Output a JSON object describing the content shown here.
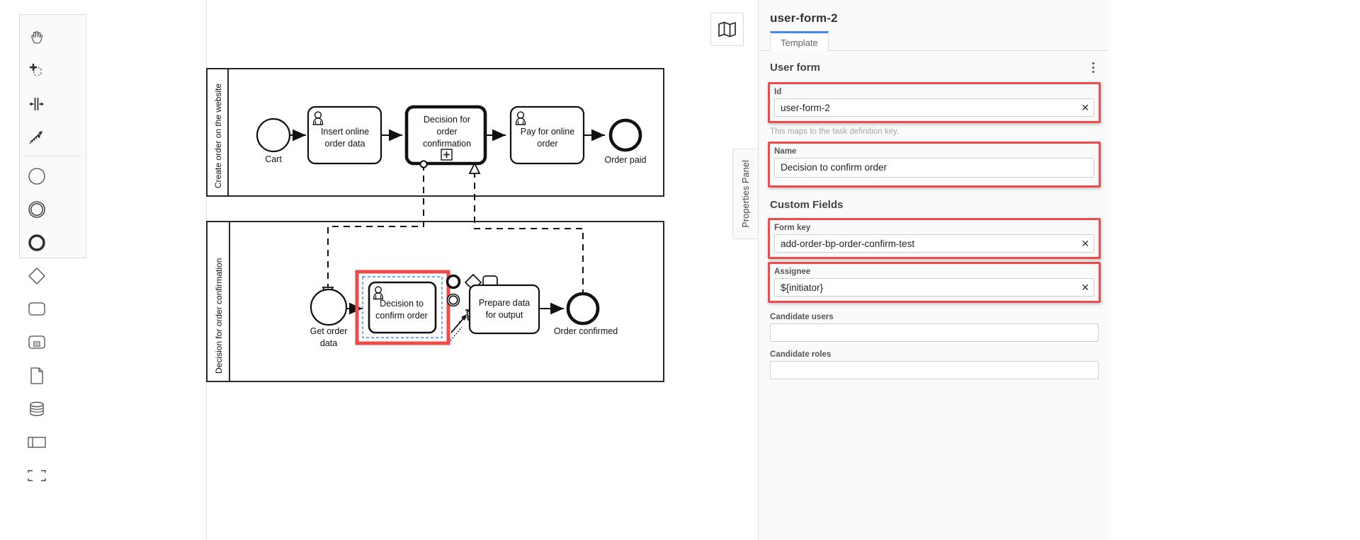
{
  "palette": {
    "tools": [
      {
        "name": "hand-tool",
        "label": "Activate the hand tool"
      },
      {
        "name": "lasso-tool",
        "label": "Activate the lasso tool"
      },
      {
        "name": "space-tool",
        "label": "Activate the create/remove space tool"
      },
      {
        "name": "global-connect-tool",
        "label": "Activate the global connect tool"
      }
    ],
    "elements": [
      {
        "name": "start-event",
        "label": "Create StartEvent"
      },
      {
        "name": "intermediate-event",
        "label": "Create Intermediate/Boundary Event"
      },
      {
        "name": "end-event",
        "label": "Create EndEvent"
      },
      {
        "name": "gateway",
        "label": "Create Gateway"
      },
      {
        "name": "task",
        "label": "Create Task"
      },
      {
        "name": "subprocess-expanded",
        "label": "Create expanded SubProcess"
      },
      {
        "name": "data-object",
        "label": "Create DataObjectReference"
      },
      {
        "name": "data-store",
        "label": "Create DataStoreReference"
      },
      {
        "name": "participant",
        "label": "Create Pool/Participant"
      },
      {
        "name": "group",
        "label": "Create Group"
      }
    ]
  },
  "minimap": {
    "icon": "map-icon",
    "label": "Toggle minimap"
  },
  "diagram": {
    "pools": [
      {
        "name": "Create order on the website",
        "nodes": [
          {
            "id": "cart",
            "type": "start-event",
            "label": "Cart"
          },
          {
            "id": "insert-online-order-data",
            "type": "user-task",
            "label": "Insert online order data"
          },
          {
            "id": "decision-for-order-confirmation",
            "type": "call-activity",
            "label": "Decision for order confirmation",
            "marker": "+"
          },
          {
            "id": "pay-for-online-order",
            "type": "user-task",
            "label": "Pay for online order"
          },
          {
            "id": "order-paid",
            "type": "end-event",
            "label": "Order paid"
          }
        ]
      },
      {
        "name": "Decision for order confirmation",
        "nodes": [
          {
            "id": "get-order-data",
            "type": "start-event",
            "label": "Get order data"
          },
          {
            "id": "decision-to-confirm-order",
            "type": "user-task",
            "label": "Decision to confirm order",
            "selected": true
          },
          {
            "id": "prepare-data-for-output",
            "type": "user-task",
            "label": "Prepare data for output"
          },
          {
            "id": "order-confirmed",
            "type": "end-event",
            "label": "Order confirmed"
          }
        ]
      }
    ],
    "context_pad": {
      "items": [
        {
          "name": "append-end-event-icon",
          "label": "Append EndEvent"
        },
        {
          "name": "append-gateway-icon",
          "label": "Append Gateway"
        },
        {
          "name": "append-task-icon",
          "label": "Append Task"
        },
        {
          "name": "append-intermediate-event-icon",
          "label": "Append Intermediate/Boundary Event"
        },
        {
          "name": "connect-icon",
          "label": "Connect using Sequence/MessageFlow"
        },
        {
          "name": "delete-icon",
          "label": "Remove"
        },
        {
          "name": "wrench-icon",
          "label": "Change type"
        }
      ]
    }
  },
  "panel": {
    "title": "user-form-2",
    "tabs": [
      {
        "label": "Template",
        "active": true
      }
    ],
    "group": {
      "label": "User form",
      "menu_icon": "kebab-menu-icon"
    },
    "fields": {
      "id": {
        "label": "Id",
        "value": "user-form-2",
        "hint": "This maps to the task definition key.",
        "clear": "✕",
        "highlighted": true
      },
      "name": {
        "label": "Name",
        "value": "Decision to confirm order",
        "highlighted": true
      },
      "custom_fields_title": "Custom Fields",
      "form_key": {
        "label": "Form key",
        "value": "add-order-bp-order-confirm-test",
        "clear": "✕",
        "highlighted": true
      },
      "assignee": {
        "label": "Assignee",
        "value": "${initiator}",
        "clear": "✕",
        "highlighted": true
      },
      "candidate_users": {
        "label": "Candidate users",
        "value": "",
        "placeholder": ""
      },
      "candidate_roles": {
        "label": "Candidate roles",
        "value": "",
        "placeholder": ""
      }
    },
    "side_tab": {
      "label": "Properties Panel"
    }
  },
  "colors": {
    "accent": "#4285f4",
    "highlight": "#ef4b48",
    "panel_bg": "#fafafa",
    "selection": "#4285f4"
  }
}
